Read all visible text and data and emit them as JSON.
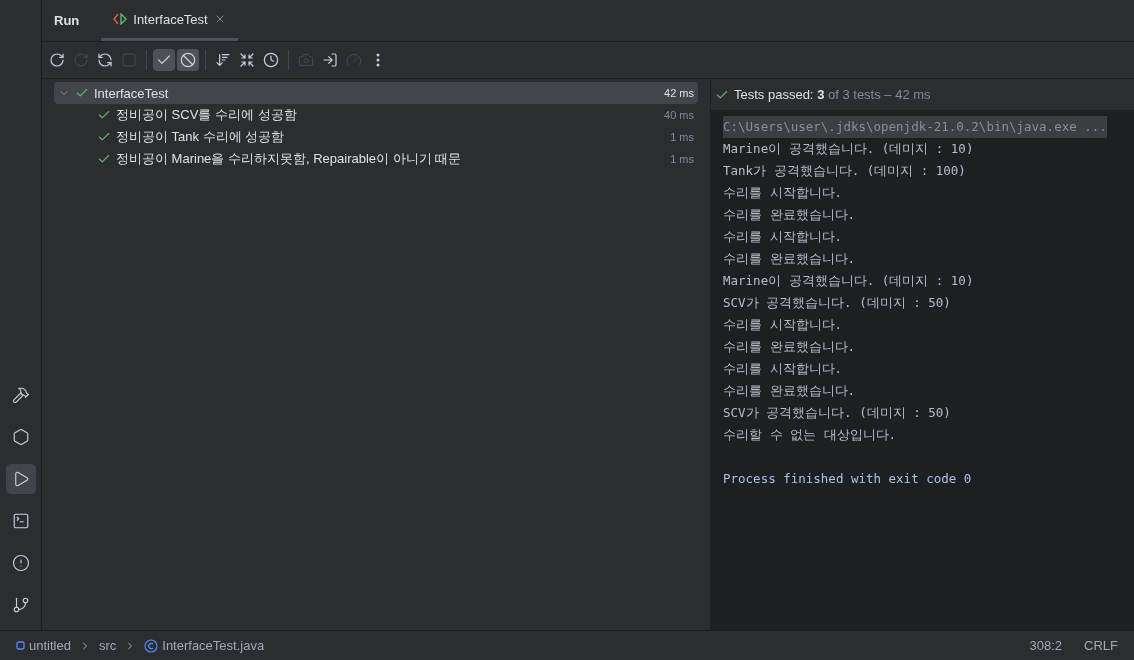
{
  "tool_strip": [
    {
      "kind": "build",
      "selected": false
    },
    {
      "kind": "services",
      "selected": false
    },
    {
      "kind": "run",
      "selected": true
    },
    {
      "kind": "terminal",
      "selected": false
    },
    {
      "kind": "problems",
      "selected": false
    },
    {
      "kind": "git",
      "selected": false
    }
  ],
  "panel": {
    "title": "Run",
    "tabs": [
      {
        "label": "InterfaceTest",
        "selected": true
      }
    ]
  },
  "toolbar": [
    {
      "kind": "rerun",
      "disabled": false,
      "on": false
    },
    {
      "kind": "rerun-failed",
      "disabled": true,
      "on": false
    },
    {
      "kind": "rerun-auto",
      "disabled": false,
      "on": false
    },
    {
      "kind": "stop",
      "disabled": true,
      "on": false
    },
    {
      "kind": "sep"
    },
    {
      "kind": "show-passed",
      "disabled": false,
      "on": true
    },
    {
      "kind": "show-ignored",
      "disabled": false,
      "on": true
    },
    {
      "kind": "sep"
    },
    {
      "kind": "sort",
      "disabled": false,
      "on": false
    },
    {
      "kind": "collapse",
      "disabled": false,
      "on": false
    },
    {
      "kind": "history",
      "disabled": false,
      "on": false
    },
    {
      "kind": "sep"
    },
    {
      "kind": "camera",
      "disabled": true,
      "on": false
    },
    {
      "kind": "import",
      "disabled": false,
      "on": false
    },
    {
      "kind": "gauge",
      "disabled": true,
      "on": false
    },
    {
      "kind": "more",
      "disabled": false,
      "on": false
    }
  ],
  "test_tree": [
    {
      "name": "InterfaceTest",
      "duration": "42 ms",
      "passed": true,
      "selected": true,
      "expanded": true,
      "children": [
        {
          "name": "정비공이 SCV를 수리에 성공함",
          "duration": "40 ms",
          "passed": true,
          "selected": false
        },
        {
          "name": "정비공이 Tank 수리에 성공함",
          "duration": "1 ms",
          "passed": true,
          "selected": false
        },
        {
          "name": "정비공이 Marine을 수리하지못함, Repairable이 아니기 때문",
          "duration": "1 ms",
          "passed": true,
          "selected": false
        }
      ]
    }
  ],
  "summary": {
    "passed": true,
    "label": "Tests passed:",
    "count": "3",
    "rest": "of 3 tests – 42 ms"
  },
  "console": [
    {
      "kind": "command",
      "text": "C:\\Users\\user\\.jdks\\openjdk-21.0.2\\bin\\java.exe ..."
    },
    {
      "kind": "output",
      "text": "Marine이 공격했습니다. (데미지 : 10)"
    },
    {
      "kind": "output",
      "text": "Tank가 공격했습니다. (데미지 : 100)"
    },
    {
      "kind": "output",
      "text": "수리를 시작합니다."
    },
    {
      "kind": "output",
      "text": "수리를 완료했습니다."
    },
    {
      "kind": "output",
      "text": "수리를 시작합니다."
    },
    {
      "kind": "output",
      "text": "수리를 완료했습니다."
    },
    {
      "kind": "output",
      "text": "Marine이 공격했습니다. (데미지 : 10)"
    },
    {
      "kind": "output",
      "text": "SCV가 공격했습니다. (데미지 : 50)"
    },
    {
      "kind": "output",
      "text": "수리를 시작합니다."
    },
    {
      "kind": "output",
      "text": "수리를 완료했습니다."
    },
    {
      "kind": "output",
      "text": "수리를 시작합니다."
    },
    {
      "kind": "output",
      "text": "수리를 완료했습니다."
    },
    {
      "kind": "output",
      "text": "SCV가 공격했습니다. (데미지 : 50)"
    },
    {
      "kind": "output",
      "text": "수리할 수 없는 대상입니다."
    },
    {
      "kind": "blank"
    },
    {
      "kind": "exit",
      "text": "Process finished with exit code 0"
    }
  ],
  "status_bar": {
    "breadcrumbs": [
      {
        "kind": "module",
        "text": "untitled"
      },
      {
        "kind": "folder",
        "text": "src"
      },
      {
        "kind": "class",
        "text": "InterfaceTest.java"
      }
    ],
    "position": "308:2",
    "line_ending": "CRLF"
  }
}
